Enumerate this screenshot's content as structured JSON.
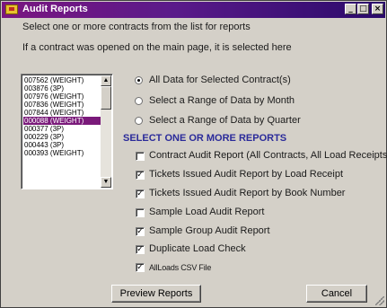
{
  "window": {
    "title": "Audit Reports",
    "minimize_label": "_",
    "maximize_label": "□",
    "close_label": "×"
  },
  "instructions": {
    "line1": "Select one or more contracts from the list for reports",
    "line2": "If a contract was opened on the main page, it is selected here"
  },
  "contracts": {
    "items": [
      "007562  (WEIGHT)",
      "003876  (3P)",
      "007976  (WEIGHT)",
      "007836  (WEIGHT)",
      "007844  (WEIGHT)",
      "000088  (WEIGHT)",
      "000377  (3P)",
      "000229  (3P)",
      "000443  (3P)",
      "000393  (WEIGHT)"
    ],
    "selected_index": 5
  },
  "range_options": {
    "all_data": "All Data for Selected Contract(s)",
    "by_month": "Select a Range of Data by Month",
    "by_quarter": "Select a Range of Data by Quarter",
    "selected": "all_data"
  },
  "reports": {
    "heading": "SELECT ONE OR MORE REPORTS",
    "contract_audit": {
      "label": "Contract Audit Report (All Contracts, All Load Receipts)",
      "checked": false
    },
    "tickets_by_load": {
      "label": "Tickets Issued Audit Report by Load Receipt",
      "checked": true
    },
    "tickets_by_book": {
      "label": "Tickets Issued Audit Report by Book Number",
      "checked": true
    },
    "sample_load": {
      "label": "Sample Load Audit Report",
      "checked": false
    },
    "sample_group": {
      "label": "Sample Group Audit Report",
      "checked": true
    },
    "duplicate_load": {
      "label": "Duplicate Load Check",
      "checked": true
    },
    "allloads_csv": {
      "label": "AllLoads CSV File",
      "checked": true
    }
  },
  "buttons": {
    "preview": "Preview Reports",
    "cancel": "Cancel"
  },
  "check_glyph": "✓"
}
